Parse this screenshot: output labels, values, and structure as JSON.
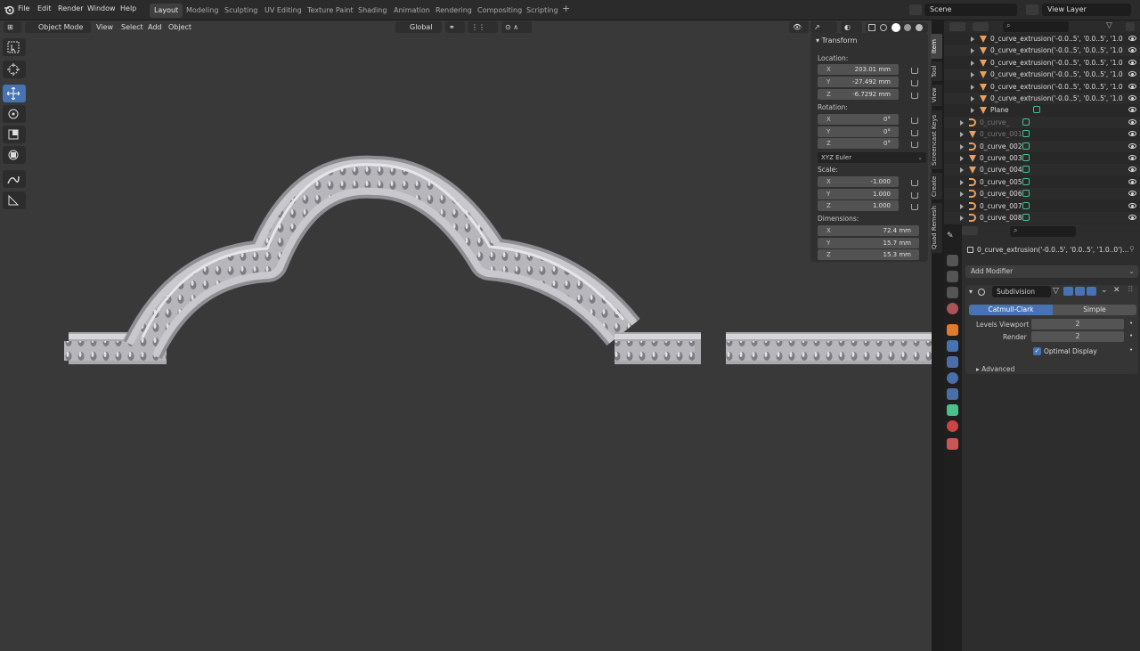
{
  "menus": [
    "File",
    "Edit",
    "Render",
    "Window",
    "Help"
  ],
  "workspaces": [
    "Layout",
    "Modeling",
    "Sculpting",
    "UV Editing",
    "Texture Paint",
    "Shading",
    "Animation",
    "Rendering",
    "Compositing",
    "Scripting"
  ],
  "active_workspace": "Layout",
  "scene": "Scene",
  "view_layer": "View Layer",
  "viewport_header": {
    "mode": "Object Mode",
    "menus": [
      "View",
      "Select",
      "Add",
      "Object"
    ],
    "orientation": "Global"
  },
  "npanel": {
    "title": "Transform",
    "location_label": "Location:",
    "location": [
      {
        "axis": "X",
        "value": "203.01 mm"
      },
      {
        "axis": "Y",
        "value": "-27.492 mm"
      },
      {
        "axis": "Z",
        "value": "-6.7292 mm"
      }
    ],
    "rotation_label": "Rotation:",
    "rotation": [
      {
        "axis": "X",
        "value": "0°"
      },
      {
        "axis": "Y",
        "value": "0°"
      },
      {
        "axis": "Z",
        "value": "0°"
      }
    ],
    "rotation_mode": "XYZ Euler",
    "scale_label": "Scale:",
    "scale": [
      {
        "axis": "X",
        "value": "-1.000"
      },
      {
        "axis": "Y",
        "value": "1.000"
      },
      {
        "axis": "Z",
        "value": "1.000"
      }
    ],
    "dimensions_label": "Dimensions:",
    "dimensions": [
      {
        "axis": "X",
        "value": "72.4 mm"
      },
      {
        "axis": "Y",
        "value": "15.7 mm"
      },
      {
        "axis": "Z",
        "value": "15.3 mm"
      }
    ]
  },
  "sidebar_tabs": [
    "Item",
    "Tool",
    "View",
    "Screencast Keys",
    "Create",
    "Quad Remesh"
  ],
  "outliner": {
    "rows": [
      {
        "name": "0_curve_extrusion('-0.0..5', '0.0..5', '1.0",
        "type": "mesh",
        "dim": false
      },
      {
        "name": "0_curve_extrusion('-0.0..5', '0.0..5', '1.0",
        "type": "mesh",
        "dim": false
      },
      {
        "name": "0_curve_extrusion('-0.0..5', '0.0..5', '1.0",
        "type": "mesh",
        "dim": false
      },
      {
        "name": "0_curve_extrusion('-0.0..5', '0.0..5', '1.0",
        "type": "mesh",
        "dim": false
      },
      {
        "name": "0_curve_extrusion('-0.0..5', '0.0..5', '1.0",
        "type": "mesh",
        "dim": false
      },
      {
        "name": "0_curve_extrusion('-0.0..5', '0.0..5', '1.0",
        "type": "mesh",
        "dim": false
      },
      {
        "name": "Plane",
        "type": "mesh",
        "dim": false
      },
      {
        "name": "0_curve_",
        "type": "curve",
        "dim": true
      },
      {
        "name": "0_curve_001",
        "type": "mesh",
        "dim": true
      },
      {
        "name": "0_curve_002",
        "type": "curve",
        "dim": false
      },
      {
        "name": "0_curve_003",
        "type": "mesh",
        "dim": false
      },
      {
        "name": "0_curve_004",
        "type": "mesh",
        "dim": false
      },
      {
        "name": "0_curve_005",
        "type": "curve",
        "dim": false
      },
      {
        "name": "0_curve_006",
        "type": "curve",
        "dim": false
      },
      {
        "name": "0_curve_007",
        "type": "curve",
        "dim": false
      },
      {
        "name": "0_curve_008",
        "type": "curve",
        "dim": false
      }
    ]
  },
  "properties": {
    "object_name": "0_curve_extrusion('-0.0..5', '0.0..5', '1.0..0')...",
    "add_modifier": "Add Modifier",
    "modifier_name": "Subdivision",
    "tabs": [
      "Catmull-Clark",
      "Simple"
    ],
    "active_tab": "Catmull-Clark",
    "levels_viewport_label": "Levels Viewport",
    "levels_viewport": "2",
    "render_label": "Render",
    "render": "2",
    "optimal_display": "Optimal Display",
    "advanced": "Advanced"
  },
  "colors": {
    "accent": "#4772b3",
    "viewport_bg": "#393939",
    "mesh_icon": "#e8a060",
    "data_icon": "#4cbf8a"
  }
}
